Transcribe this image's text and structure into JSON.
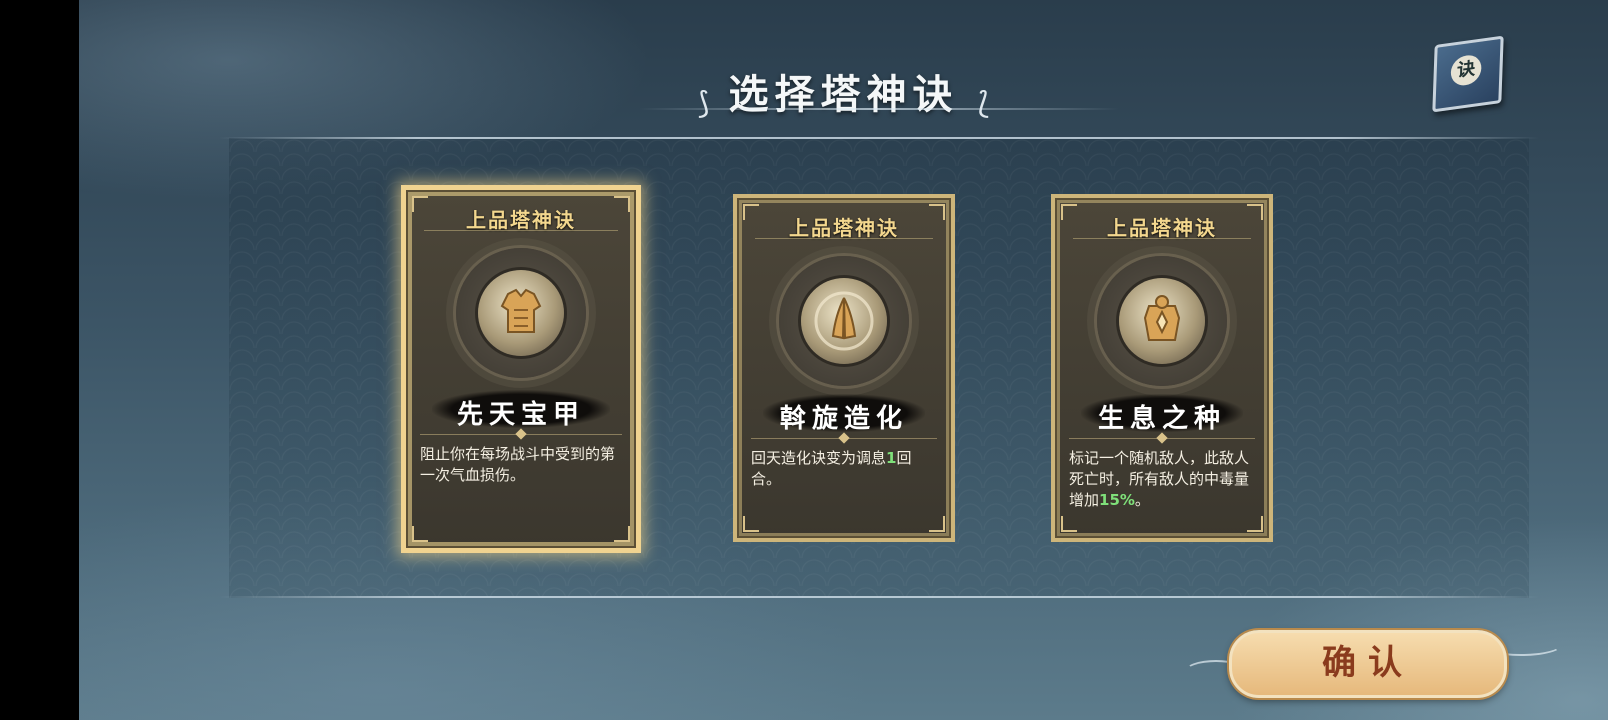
{
  "header": {
    "title": "选择塔神诀"
  },
  "book_button": {
    "label": "诀"
  },
  "cards": [
    {
      "grade": "上品塔神诀",
      "name": "先天宝甲",
      "icon": "armor-icon",
      "selected": true,
      "desc": "阻止你在每场战斗中受到的第一次气血损伤。"
    },
    {
      "grade": "上品塔神诀",
      "name": "斡旋造化",
      "icon": "praying-hands-icon",
      "selected": false,
      "desc_before": "回天造化诀变为调息",
      "desc_highlight": "1",
      "desc_after": "回合。"
    },
    {
      "grade": "上品塔神诀",
      "name": "生息之种",
      "icon": "seed-totem-icon",
      "selected": false,
      "desc_before": "标记一个随机敌人，此敌人死亡时，所有敌人的中毒量增加",
      "desc_highlight": "15%",
      "desc_after": "。"
    }
  ],
  "confirm_button": {
    "label": "确认"
  },
  "colors": {
    "accent_gold": "#f0d390",
    "highlight_green": "#7fe07a",
    "confirm_text": "#8a3b1d"
  }
}
